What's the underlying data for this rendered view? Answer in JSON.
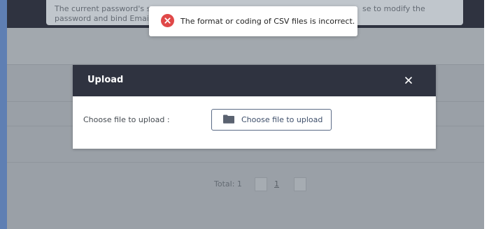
{
  "banner": {
    "line1": "The current password's se",
    "line2": "password and bind Email",
    "line1_tail": "se to modify the"
  },
  "toast": {
    "message": "The format or coding of CSV files is incorrect.",
    "icon": "error-icon",
    "color": "#e04848"
  },
  "modal": {
    "title": "Upload",
    "close_icon": "close-icon",
    "label": "Choose file to upload :",
    "button_label": "Choose file to upload",
    "button_icon": "folder-icon"
  },
  "pagination": {
    "total_label": "Total: 1",
    "current_page": "1"
  },
  "colors": {
    "header_bg": "#2f3340",
    "overlay_bg": "#9aa0a7",
    "button_border": "#5b6b86"
  }
}
